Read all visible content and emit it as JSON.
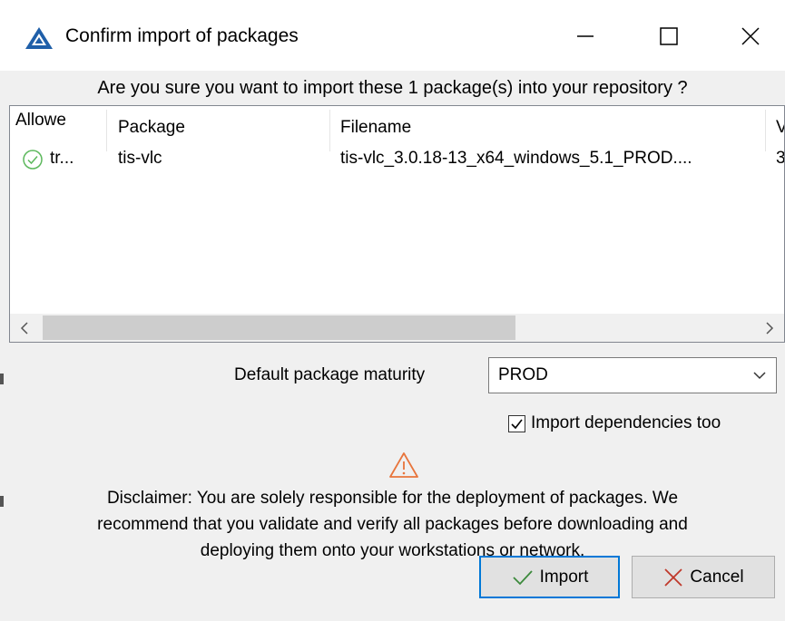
{
  "window": {
    "title": "Confirm import of packages",
    "controls": {
      "minimize": "minimize-icon",
      "maximize": "maximize-icon",
      "close": "close-icon"
    }
  },
  "question": "Are you sure you want to import these 1 package(s) into your repository ?",
  "table": {
    "columns": [
      "Allowe",
      "Package",
      "Filename",
      "V"
    ],
    "rows": [
      {
        "allowed": "tr...",
        "package": "tis-vlc",
        "filename": "tis-vlc_3.0.18-13_x64_windows_5.1_PROD....",
        "version": "3"
      }
    ]
  },
  "maturity": {
    "label": "Default package maturity",
    "value": "PROD"
  },
  "dependencies": {
    "label": "Import dependencies too",
    "checked": true
  },
  "disclaimer": {
    "lines": [
      "Disclaimer: You are solely responsible for the deployment of packages. We",
      "recommend that you validate and verify all packages before downloading and",
      "deploying them onto your workstations or network."
    ]
  },
  "buttons": {
    "import": "Import",
    "cancel": "Cancel"
  },
  "colors": {
    "accent": "#0078d7",
    "ok_green": "#5cb85c",
    "warning": "#e8743b",
    "cancel_red": "#c0392b"
  }
}
